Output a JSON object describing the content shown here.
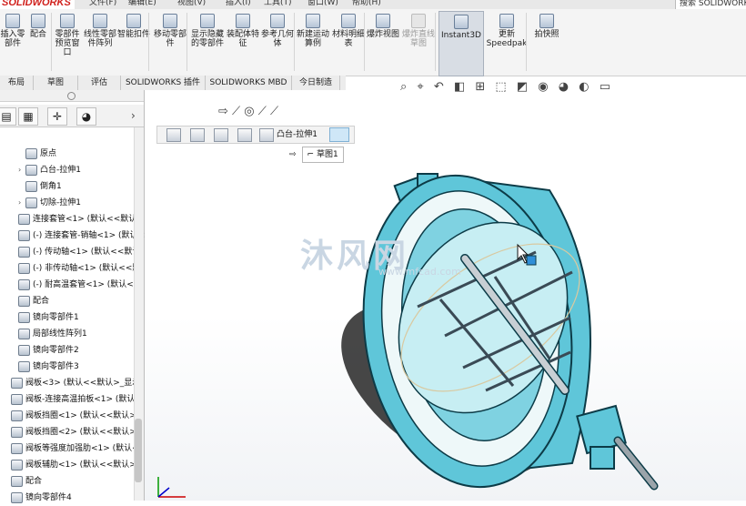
{
  "app": {
    "logo": "SOLIDWORKS",
    "search_label": "搜索 SOLIDWORKS"
  },
  "menu": [
    "文件(F)",
    "编辑(E)",
    "视图(V)",
    "插入(I)",
    "工具(T)",
    "窗口(W)",
    "帮助(H)"
  ],
  "ribbon": {
    "buttons": [
      {
        "label": "插入零部件",
        "state": "normal"
      },
      {
        "label": "配合",
        "state": "normal"
      },
      {
        "label": "零部件预览窗口",
        "state": "normal"
      },
      {
        "label": "线性零部件阵列",
        "state": "normal"
      },
      {
        "label": "智能扣件",
        "state": "normal"
      },
      {
        "label": "移动零部件",
        "state": "normal"
      },
      {
        "label": "显示隐藏的零部件",
        "state": "normal"
      },
      {
        "label": "装配体特征",
        "state": "normal"
      },
      {
        "label": "参考几何体",
        "state": "normal"
      },
      {
        "label": "新建运动算例",
        "state": "normal"
      },
      {
        "label": "材料明细表",
        "state": "normal"
      },
      {
        "label": "爆炸视图",
        "state": "normal"
      },
      {
        "label": "爆炸直线草图",
        "state": "disabled"
      },
      {
        "label": "Instant3D",
        "state": "active"
      },
      {
        "label": "更新Speedpak",
        "state": "normal"
      },
      {
        "label": "拍快照",
        "state": "normal"
      }
    ]
  },
  "tabs": [
    "布局",
    "草图",
    "评估",
    "SOLIDWORKS 插件",
    "SOLIDWORKS MBD",
    "今日制造"
  ],
  "tree": {
    "items": [
      {
        "label": "原点",
        "indent": 2,
        "expand": ""
      },
      {
        "label": "凸台-拉伸1",
        "indent": 2,
        "expand": "›"
      },
      {
        "label": "倒角1",
        "indent": 2,
        "expand": ""
      },
      {
        "label": "切除-拉伸1",
        "indent": 2,
        "expand": "›"
      },
      {
        "label": "连接套管<1> (默认<<默认",
        "indent": 1,
        "expand": ""
      },
      {
        "label": "(-) 连接套管-销轴<1> (默认<",
        "indent": 1,
        "expand": ""
      },
      {
        "label": "(-) 传动轴<1> (默认<<默认",
        "indent": 1,
        "expand": ""
      },
      {
        "label": "(-) 非传动轴<1> (默认<<默",
        "indent": 1,
        "expand": ""
      },
      {
        "label": "(-) 耐高温套管<1> (默认<<",
        "indent": 1,
        "expand": ""
      },
      {
        "label": "配合",
        "indent": 1,
        "expand": ""
      },
      {
        "label": "镜向零部件1",
        "indent": 1,
        "expand": ""
      },
      {
        "label": "局部线性阵列1",
        "indent": 1,
        "expand": ""
      },
      {
        "label": "镜向零部件2",
        "indent": 1,
        "expand": ""
      },
      {
        "label": "镜向零部件3",
        "indent": 1,
        "expand": ""
      },
      {
        "label": "阀板<3> (默认<<默认>_显示状",
        "indent": 0,
        "expand": ""
      },
      {
        "label": "阀板-连接高温拍板<1> (默认<",
        "indent": 0,
        "expand": ""
      },
      {
        "label": "阀板挡圈<1> (默认<<默认>_显",
        "indent": 0,
        "expand": ""
      },
      {
        "label": "阀板挡圈<2> (默认<<默认>_显",
        "indent": 0,
        "expand": ""
      },
      {
        "label": "阀板等强度加强肋<1> (默认<<",
        "indent": 0,
        "expand": ""
      },
      {
        "label": "阀板辅肋<1> (默认<<默认>_显",
        "indent": 0,
        "expand": ""
      },
      {
        "label": "配合",
        "indent": 0,
        "expand": ""
      },
      {
        "label": "镜向零部件4",
        "indent": 0,
        "expand": ""
      }
    ]
  },
  "viewport": {
    "breadcrumb_label": "凸台-拉伸1",
    "sketch_label": "草图1",
    "watermark": "沐风网",
    "watermark_url": "www.mfcad.com"
  },
  "colors": {
    "model_fill": "#5fc6d9",
    "model_stroke": "#0c3b47",
    "plate": "#c7eef3",
    "ring": "#eef8f9"
  }
}
